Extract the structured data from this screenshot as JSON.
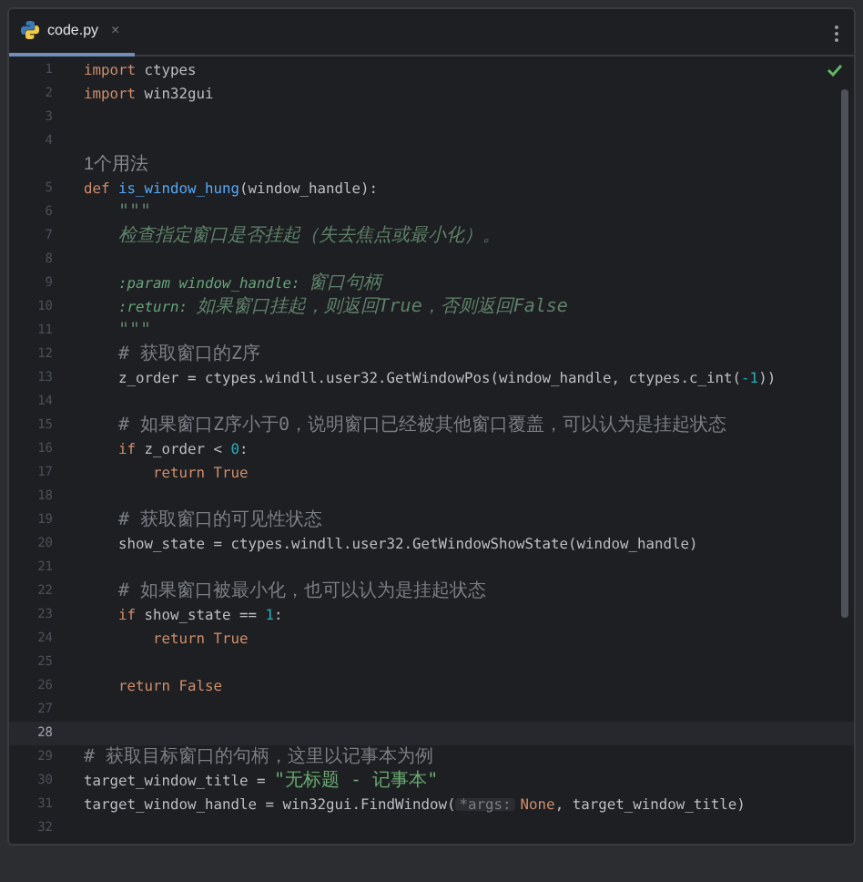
{
  "tab": {
    "title": "code.py",
    "close": "×",
    "selected": true
  },
  "lines": [
    {
      "number": "1",
      "current": false,
      "tokens": [
        {
          "kind": "kw",
          "text": "import "
        },
        {
          "kind": "plain",
          "text": "ctypes"
        }
      ]
    },
    {
      "number": "2",
      "current": false,
      "tokens": [
        {
          "kind": "kw",
          "text": "import "
        },
        {
          "kind": "plain",
          "text": "win32gui"
        }
      ]
    },
    {
      "number": "3",
      "current": false
    },
    {
      "number": "4",
      "current": false
    },
    {
      "kind": "usage",
      "text": "1个用法"
    },
    {
      "number": "5",
      "current": false,
      "tokens": [
        {
          "kind": "kw",
          "text": "def "
        },
        {
          "kind": "fn",
          "text": "is_window_hung"
        },
        {
          "kind": "plain",
          "text": "(window_handle):"
        }
      ],
      "children": [
        {
          "number": "6",
          "current": false,
          "tokens": [
            {
              "kind": "doc",
              "text": "\"\"\""
            }
          ]
        },
        {
          "number": "7",
          "current": false,
          "tokens": [
            {
              "kind": "doc",
              "text": "检查指定窗口是否挂起（失去焦点或最小化）。"
            }
          ]
        },
        {
          "number": "8",
          "current": false
        },
        {
          "number": "9",
          "current": false,
          "tokens": [
            {
              "kind": "doctag",
              "text": ":param "
            },
            {
              "kind": "docparam",
              "text": "window_handle"
            },
            {
              "kind": "doctag",
              "text": ": "
            },
            {
              "kind": "doc",
              "text": "窗口句柄"
            }
          ]
        },
        {
          "number": "10",
          "current": false,
          "tokens": [
            {
              "kind": "doctag",
              "text": ":return: "
            },
            {
              "kind": "doc",
              "text": "如果窗口挂起，则返回True，否则返回False"
            }
          ]
        },
        {
          "number": "11",
          "current": false,
          "tokens": [
            {
              "kind": "doc",
              "text": "\"\"\""
            }
          ]
        },
        {
          "number": "12",
          "current": false,
          "tokens": [
            {
              "kind": "comment",
              "text": "# 获取窗口的Z序"
            }
          ]
        },
        {
          "number": "13",
          "current": false,
          "tokens": [
            {
              "kind": "plain",
              "text": "z_order = ctypes.windll.user32.GetWindowPos(window_handle, ctypes.c_int("
            },
            {
              "kind": "num",
              "text": "-1"
            },
            {
              "kind": "plain",
              "text": "))"
            }
          ]
        },
        {
          "number": "14",
          "current": false
        },
        {
          "number": "15",
          "current": false,
          "tokens": [
            {
              "kind": "comment",
              "text": "# 如果窗口Z序小于0，说明窗口已经被其他窗口覆盖，可以认为是挂起状态"
            }
          ]
        },
        {
          "number": "16",
          "current": false,
          "tokens": [
            {
              "kind": "kw",
              "text": "if "
            },
            {
              "kind": "plain",
              "text": "z_order < "
            },
            {
              "kind": "num",
              "text": "0"
            },
            {
              "kind": "plain",
              "text": ":"
            }
          ],
          "children": [
            {
              "number": "17",
              "current": false,
              "tokens": [
                {
                  "kind": "kw",
                  "text": "return True"
                }
              ]
            }
          ]
        },
        {
          "number": "18",
          "current": false
        },
        {
          "number": "19",
          "current": false,
          "tokens": [
            {
              "kind": "comment",
              "text": "# 获取窗口的可见性状态"
            }
          ]
        },
        {
          "number": "20",
          "current": false,
          "tokens": [
            {
              "kind": "plain",
              "text": "show_state = ctypes.windll.user32.GetWindowShowState(window_handle)"
            }
          ]
        },
        {
          "number": "21",
          "current": false
        },
        {
          "number": "22",
          "current": false,
          "tokens": [
            {
              "kind": "comment",
              "text": "# 如果窗口被最小化，也可以认为是挂起状态"
            }
          ]
        },
        {
          "number": "23",
          "current": false,
          "tokens": [
            {
              "kind": "kw",
              "text": "if "
            },
            {
              "kind": "plain",
              "text": "show_state == "
            },
            {
              "kind": "num",
              "text": "1"
            },
            {
              "kind": "plain",
              "text": ":"
            }
          ],
          "children": [
            {
              "number": "24",
              "current": false,
              "tokens": [
                {
                  "kind": "kw",
                  "text": "return True"
                }
              ]
            }
          ]
        },
        {
          "number": "25",
          "current": false
        },
        {
          "number": "26",
          "current": false,
          "tokens": [
            {
              "kind": "kw",
              "text": "return False"
            }
          ]
        }
      ]
    },
    {
      "number": "27",
      "current": false
    },
    {
      "number": "28",
      "current": true
    },
    {
      "number": "29",
      "current": false,
      "tokens": [
        {
          "kind": "comment",
          "text": "# 获取目标窗口的句柄，这里以记事本为例"
        }
      ]
    },
    {
      "number": "30",
      "current": false,
      "tokens": [
        {
          "kind": "plain",
          "text": "target_window_title = "
        },
        {
          "kind": "str",
          "text": "\"无标题 - 记事本\""
        }
      ]
    },
    {
      "number": "31",
      "current": false,
      "tokens": [
        {
          "kind": "plain",
          "text": "target_window_handle = win32gui.FindWindow("
        },
        {
          "kind": "hint",
          "text": "*args:"
        },
        {
          "kind": "kw",
          "text": "None"
        },
        {
          "kind": "plain",
          "text": ", target_window_title)"
        }
      ]
    },
    {
      "number": "32",
      "current": false
    }
  ]
}
